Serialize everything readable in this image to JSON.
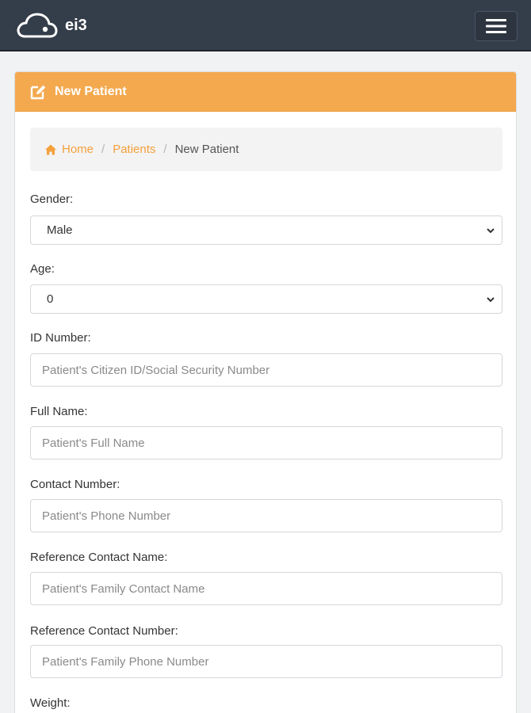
{
  "navbar": {
    "brand": "ei3",
    "logo_icon": "cloud-logo-icon",
    "menu_icon": "hamburger-menu-icon"
  },
  "card": {
    "title": "New Patient",
    "title_icon": "edit-icon"
  },
  "breadcrumb": {
    "home": "Home",
    "patients": "Patients",
    "current": "New Patient",
    "separator": "/"
  },
  "form": {
    "gender": {
      "label": "Gender:",
      "value": "Male"
    },
    "age": {
      "label": "Age:",
      "value": "0"
    },
    "id_number": {
      "label": "ID Number:",
      "placeholder": "Patient's Citizen ID/Social Security Number"
    },
    "full_name": {
      "label": "Full Name:",
      "placeholder": "Patient's Full Name"
    },
    "contact_number": {
      "label": "Contact Number:",
      "placeholder": "Patient's Phone Number"
    },
    "ref_contact_name": {
      "label": "Reference Contact Name:",
      "placeholder": "Patient's Family Contact Name"
    },
    "ref_contact_number": {
      "label": "Reference Contact Number:",
      "placeholder": "Patient's Family Phone Number"
    },
    "weight": {
      "label": "Weight:"
    }
  },
  "colors": {
    "navbar": "#343d4a",
    "accent": "#f4a94f",
    "link": "#f4a03c"
  }
}
